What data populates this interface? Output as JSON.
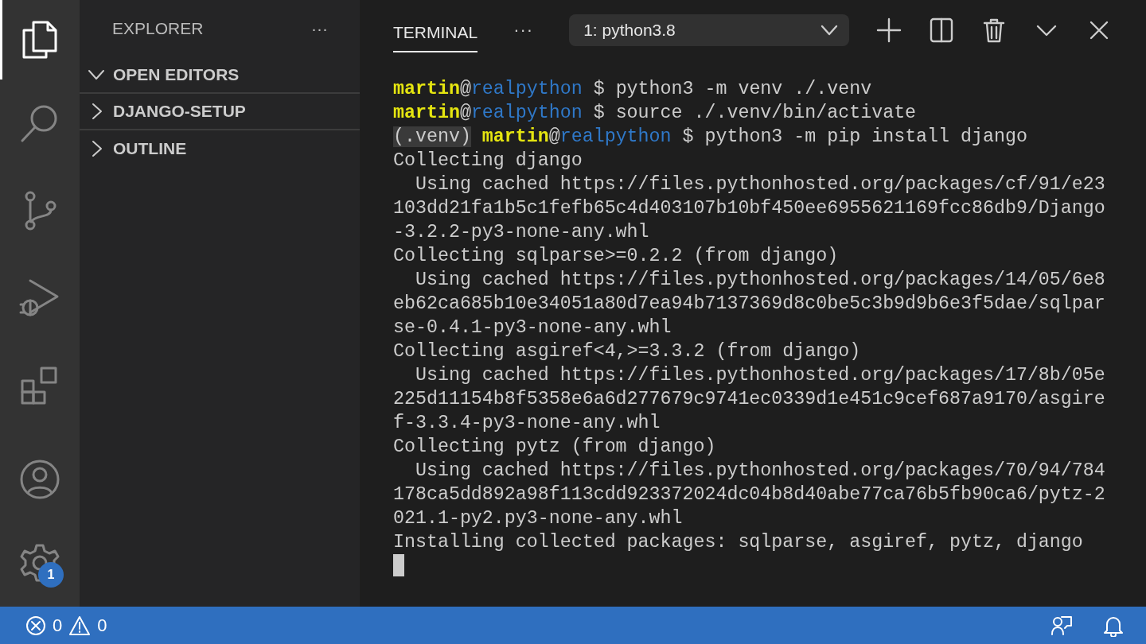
{
  "activity_bar": {
    "items": [
      {
        "kind": "files",
        "selected": true
      },
      {
        "kind": "search",
        "selected": false
      },
      {
        "kind": "source-control",
        "selected": false
      },
      {
        "kind": "debug",
        "selected": false
      },
      {
        "kind": "extensions",
        "selected": false
      }
    ],
    "bottom_items": [
      {
        "kind": "account"
      },
      {
        "kind": "settings",
        "badge": "1"
      }
    ]
  },
  "sidebar": {
    "title": "EXPLORER",
    "more": "···",
    "sections": [
      {
        "label": "OPEN EDITORS",
        "expanded": true
      },
      {
        "label": "DJANGO-SETUP",
        "expanded": false
      },
      {
        "label": "OUTLINE",
        "expanded": false
      }
    ]
  },
  "panel": {
    "tabs": [
      {
        "label": "TERMINAL",
        "selected": true
      }
    ],
    "more": "···",
    "terminal_select": {
      "value": "1: python3.8"
    },
    "actions": [
      {
        "kind": "new-terminal"
      },
      {
        "kind": "split"
      },
      {
        "kind": "delete"
      },
      {
        "kind": "maximize"
      },
      {
        "kind": "close"
      }
    ]
  },
  "terminal": {
    "lines": [
      {
        "kind": "prompt",
        "user": "martin",
        "at": "@",
        "host": "realpython",
        "command": " $ python3 -m venv ./.venv"
      },
      {
        "kind": "prompt",
        "user": "martin",
        "at": "@",
        "host": "realpython",
        "command": " $ source ./.venv/bin/activate"
      },
      {
        "kind": "prompt",
        "venv": "(.venv)",
        "user": "martin",
        "at": "@",
        "host": "realpython",
        "command": " $ python3 -m pip install django"
      },
      {
        "kind": "output",
        "text": "Collecting django"
      },
      {
        "kind": "output",
        "text": "  Using cached https://files.pythonhosted.org/packages/cf/91/e23"
      },
      {
        "kind": "output",
        "text": "103dd21fa1b5c1fefb65c4d403107b10bf450ee6955621169fcc86db9/Django"
      },
      {
        "kind": "output",
        "text": "-3.2.2-py3-none-any.whl"
      },
      {
        "kind": "output",
        "text": "Collecting sqlparse>=0.2.2 (from django)"
      },
      {
        "kind": "output",
        "text": "  Using cached https://files.pythonhosted.org/packages/14/05/6e8"
      },
      {
        "kind": "output",
        "text": "eb62ca685b10e34051a80d7ea94b7137369d8c0be5c3b9d9b6e3f5dae/sqlpar"
      },
      {
        "kind": "output",
        "text": "se-0.4.1-py3-none-any.whl"
      },
      {
        "kind": "output",
        "text": "Collecting asgiref<4,>=3.3.2 (from django)"
      },
      {
        "kind": "output",
        "text": "  Using cached https://files.pythonhosted.org/packages/17/8b/05e"
      },
      {
        "kind": "output",
        "text": "225d11154b8f5358e6a6d277679c9741ec0339d1e451c9cef687a9170/asgire"
      },
      {
        "kind": "output",
        "text": "f-3.3.4-py3-none-any.whl"
      },
      {
        "kind": "output",
        "text": "Collecting pytz (from django)"
      },
      {
        "kind": "output",
        "text": "  Using cached https://files.pythonhosted.org/packages/70/94/784"
      },
      {
        "kind": "output",
        "text": "178ca5dd892a98f113cdd923372024dc04b8d40abe77ca76b5fb90ca6/pytz-2"
      },
      {
        "kind": "output",
        "text": "021.1-py2.py3-none-any.whl"
      },
      {
        "kind": "output",
        "text": "Installing collected packages: sqlparse, asgiref, pytz, django"
      },
      {
        "kind": "cursor"
      }
    ]
  },
  "status_bar": {
    "errors": "0",
    "warnings": "0",
    "right_items": [
      {
        "kind": "feedback"
      },
      {
        "kind": "notifications"
      }
    ]
  }
}
